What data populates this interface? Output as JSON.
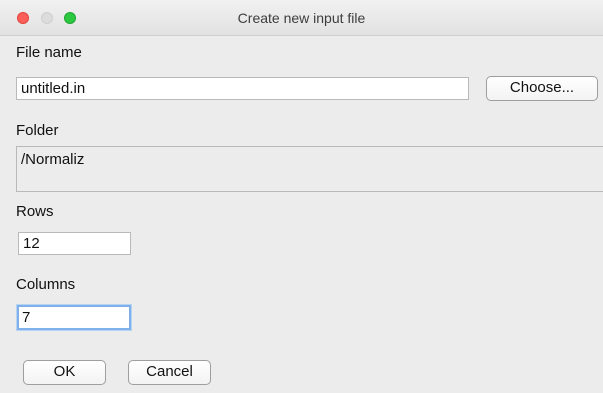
{
  "window": {
    "title": "Create new input file"
  },
  "file_name": {
    "label": "File name",
    "value": "untitled.in",
    "choose_button": "Choose..."
  },
  "folder": {
    "label": "Folder",
    "value": "/Normaliz"
  },
  "rows": {
    "label": "Rows",
    "value": "12"
  },
  "columns": {
    "label": "Columns",
    "value": "7"
  },
  "buttons": {
    "ok": "OK",
    "cancel": "Cancel"
  },
  "colors": {
    "close": "#fc5f57",
    "minimize_disabled": "#dcdcdc",
    "maximize": "#2bc840",
    "focus_ring": "#7fb0ea"
  }
}
